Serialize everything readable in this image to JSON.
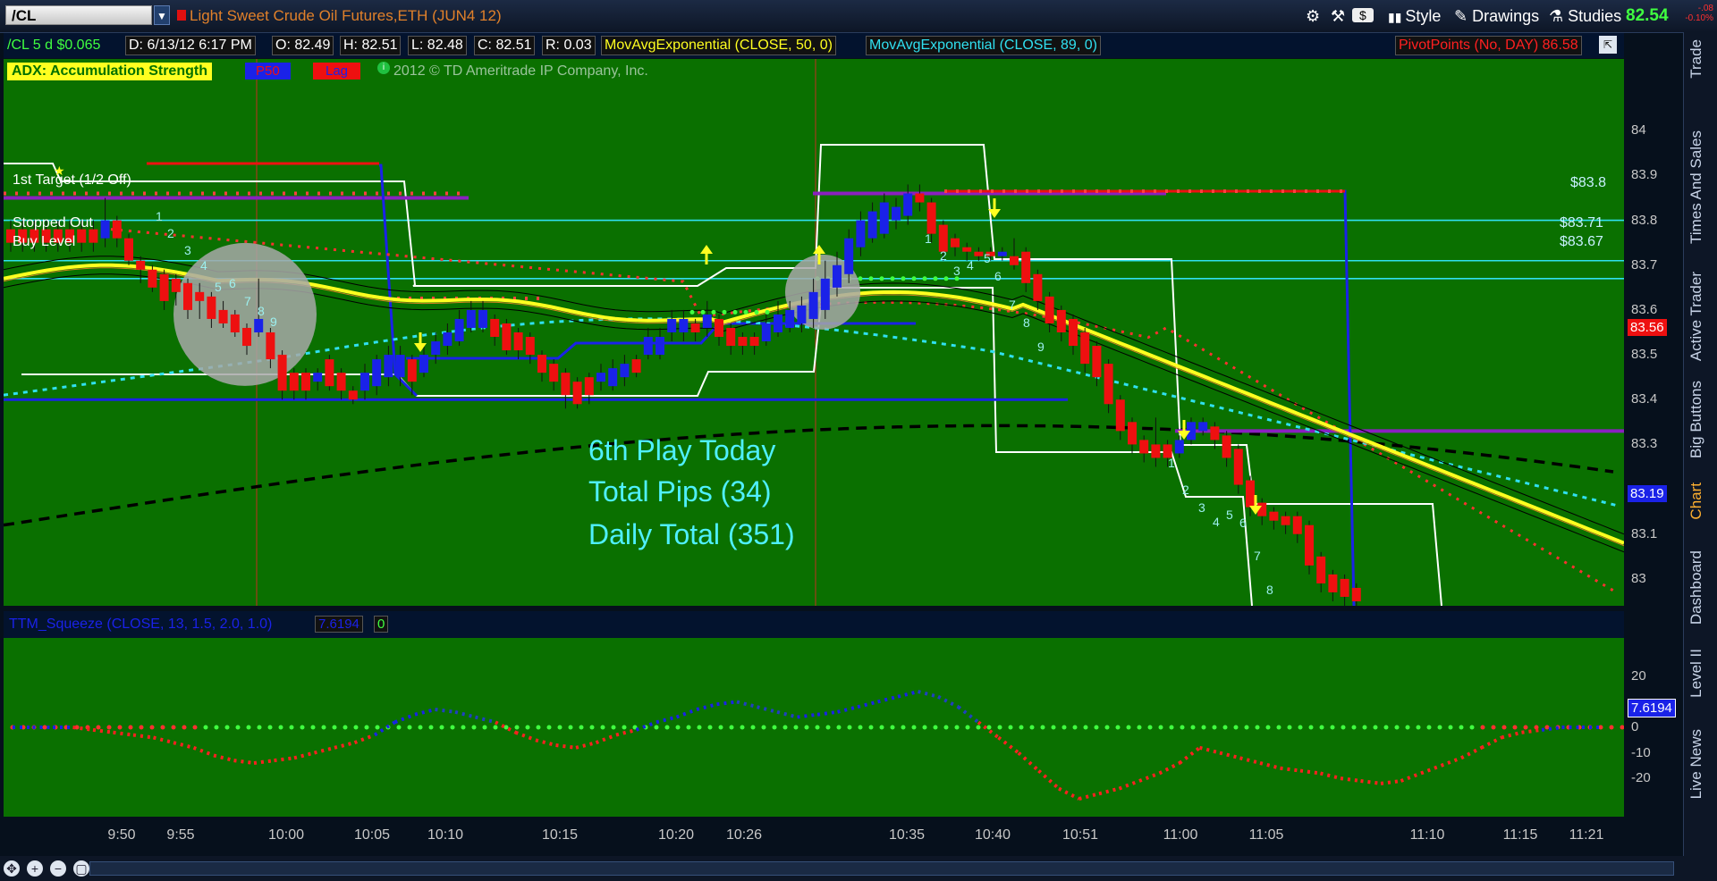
{
  "header": {
    "symbol": "/CL",
    "title": "Light Sweet Crude Oil Futures,ETH (JUN4 12)",
    "tools": {
      "style": "Style",
      "drawings": "Drawings",
      "studies": "Studies",
      "dollar": "$"
    },
    "last_price": "82.54",
    "change_line1": "-.08",
    "change_line2": "-0.10%"
  },
  "infobar": {
    "symbol_desc": "/CL 5 d $0.065",
    "date": "D: 6/13/12 6:17 PM",
    "open": "O: 82.49",
    "high": "H: 82.51",
    "low": "L: 82.48",
    "close": "C: 82.51",
    "range": "R: 0.03",
    "ema50": "MovAvgExponential (CLOSE, 50, 0)",
    "ema89": "MovAvgExponential (CLOSE, 89, 0)",
    "pivots": "PivotPoints (No, DAY)",
    "pivot_value": "86.58"
  },
  "study_bar": {
    "adx": "ADX:  Accumulation Strength",
    "p50": "P50",
    "lag": "Lag",
    "copyright": "2012 © TD Ameritrade IP Company, Inc."
  },
  "chart_labels": {
    "first_target": "1st Target (1/2 Off)",
    "stopped_out": "Stopped Out",
    "buy_level": "Buy Level",
    "level_1": "$83.8",
    "level_2": "$83.71",
    "level_3": "$83.67",
    "play": "6th Play Today",
    "pips": "Total Pips (34)",
    "daily": "Daily Total (351)"
  },
  "lower": {
    "title": "TTM_Squeeze (CLOSE, 13, 1.5, 2.0, 1.0)",
    "value": "7.6194",
    "alert": "0"
  },
  "sidebar_tabs": [
    "Trade",
    "Times And Sales",
    "Active Trader",
    "Big Buttons",
    "Chart",
    "Dashboard",
    "Level II",
    "Live News"
  ],
  "colors": {
    "chart_bg": "#0a7000",
    "up": "#1a22e8",
    "down": "#ee1010",
    "ema50": "#ffff20",
    "ema89": "#30e0f0",
    "ma_long": "#000000"
  },
  "chart_data": [
    {
      "type": "candlestick",
      "title": "Light Sweet Crude Oil Futures,ETH (JUN4 12)",
      "ylim": [
        82.94,
        84.16
      ],
      "y_ticks": [
        84,
        83.9,
        83.8,
        83.7,
        83.6,
        83.5,
        83.4,
        83.3,
        83.2,
        83.1,
        83
      ],
      "y_tick_labels": [
        "84",
        "83.9",
        "83.8",
        "83.7",
        "83.6",
        "83.5",
        "83.4",
        "83.3",
        "",
        "83.1",
        "83"
      ],
      "x_tick_labels": [
        "9:50",
        "9:55",
        "10:00",
        "10:05",
        "10:10",
        "10:15",
        "10:20",
        "10:26",
        "10:35",
        "10:40",
        "10:51",
        "11:00",
        "11:05",
        "11:10",
        "11:15",
        "11:21"
      ],
      "price_badges": [
        {
          "value": "83.56",
          "color": "#ee1010"
        },
        {
          "value": "83.19",
          "color": "#1a22e8"
        }
      ],
      "horizontal_levels": [
        83.8,
        83.71,
        83.67
      ],
      "candles": [
        [
          83.78,
          83.75,
          83.8,
          83.73
        ],
        [
          83.78,
          83.75,
          83.8,
          83.73
        ],
        [
          83.78,
          83.75,
          83.8,
          83.73
        ],
        [
          83.78,
          83.75,
          83.8,
          83.73
        ],
        [
          83.78,
          83.75,
          83.8,
          83.73
        ],
        [
          83.78,
          83.75,
          83.8,
          83.73
        ],
        [
          83.78,
          83.75,
          83.8,
          83.73
        ],
        [
          83.78,
          83.75,
          83.8,
          83.73
        ],
        [
          83.76,
          83.8,
          83.85,
          83.74
        ],
        [
          83.8,
          83.76,
          83.81,
          83.74
        ],
        [
          83.76,
          83.71,
          83.77,
          83.7
        ],
        [
          83.71,
          83.69,
          83.72,
          83.66
        ],
        [
          83.69,
          83.65,
          83.7,
          83.64
        ],
        [
          83.68,
          83.62,
          83.69,
          83.6
        ],
        [
          83.67,
          83.64,
          83.68,
          83.61
        ],
        [
          83.66,
          83.6,
          83.67,
          83.58
        ],
        [
          83.64,
          83.62,
          83.66,
          83.58
        ],
        [
          83.63,
          83.58,
          83.64,
          83.56
        ],
        [
          83.6,
          83.57,
          83.62,
          83.56
        ],
        [
          83.59,
          83.55,
          83.6,
          83.54
        ],
        [
          83.56,
          83.52,
          83.57,
          83.5
        ],
        [
          83.55,
          83.58,
          83.67,
          83.54
        ],
        [
          83.55,
          83.49,
          83.56,
          83.47
        ],
        [
          83.5,
          83.42,
          83.51,
          83.4
        ],
        [
          83.46,
          83.42,
          83.47,
          83.4
        ],
        [
          83.46,
          83.42,
          83.47,
          83.4
        ],
        [
          83.44,
          83.46,
          83.47,
          83.42
        ],
        [
          83.49,
          83.43,
          83.5,
          83.42
        ],
        [
          83.46,
          83.42,
          83.47,
          83.4
        ],
        [
          83.42,
          83.4,
          83.43,
          83.39
        ],
        [
          83.42,
          83.46,
          83.48,
          83.4
        ],
        [
          83.43,
          83.49,
          83.5,
          83.41
        ],
        [
          83.45,
          83.5,
          83.52,
          83.43
        ],
        [
          83.45,
          83.5,
          83.52,
          83.43
        ],
        [
          83.49,
          83.44,
          83.5,
          83.41
        ],
        [
          83.46,
          83.5,
          83.52,
          83.45
        ],
        [
          83.5,
          83.53,
          83.55,
          83.48
        ],
        [
          83.52,
          83.55,
          83.57,
          83.5
        ],
        [
          83.53,
          83.58,
          83.6,
          83.52
        ],
        [
          83.56,
          83.6,
          83.62,
          83.55
        ],
        [
          83.56,
          83.6,
          83.62,
          83.55
        ],
        [
          83.58,
          83.54,
          83.59,
          83.52
        ],
        [
          83.57,
          83.51,
          83.58,
          83.5
        ],
        [
          83.55,
          83.51,
          83.56,
          83.49
        ],
        [
          83.54,
          83.5,
          83.55,
          83.48
        ],
        [
          83.5,
          83.46,
          83.51,
          83.44
        ],
        [
          83.48,
          83.44,
          83.49,
          83.42
        ],
        [
          83.46,
          83.41,
          83.47,
          83.38
        ],
        [
          83.44,
          83.39,
          83.45,
          83.38
        ],
        [
          83.45,
          83.41,
          83.46,
          83.39
        ],
        [
          83.44,
          83.46,
          83.48,
          83.42
        ],
        [
          83.43,
          83.47,
          83.49,
          83.42
        ],
        [
          83.45,
          83.48,
          83.5,
          83.43
        ],
        [
          83.49,
          83.46,
          83.5,
          83.45
        ],
        [
          83.5,
          83.54,
          83.56,
          83.49
        ],
        [
          83.5,
          83.54,
          83.56,
          83.49
        ],
        [
          83.55,
          83.58,
          83.6,
          83.53
        ],
        [
          83.55,
          83.58,
          83.6,
          83.53
        ],
        [
          83.57,
          83.55,
          83.58,
          83.53
        ],
        [
          83.56,
          83.59,
          83.62,
          83.54
        ],
        [
          83.58,
          83.54,
          83.59,
          83.52
        ],
        [
          83.56,
          83.52,
          83.57,
          83.5
        ],
        [
          83.54,
          83.52,
          83.55,
          83.5
        ],
        [
          83.54,
          83.52,
          83.55,
          83.5
        ],
        [
          83.53,
          83.57,
          83.59,
          83.52
        ],
        [
          83.55,
          83.59,
          83.62,
          83.54
        ],
        [
          83.56,
          83.6,
          83.62,
          83.55
        ],
        [
          83.57,
          83.61,
          83.63,
          83.55
        ],
        [
          83.58,
          83.64,
          83.67,
          83.56
        ],
        [
          83.6,
          83.67,
          83.71,
          83.58
        ],
        [
          83.65,
          83.7,
          83.73,
          83.63
        ],
        [
          83.68,
          83.76,
          83.78,
          83.66
        ],
        [
          83.74,
          83.8,
          83.82,
          83.72
        ],
        [
          83.76,
          83.82,
          83.84,
          83.75
        ],
        [
          83.77,
          83.84,
          83.86,
          83.76
        ],
        [
          83.8,
          83.83,
          83.85,
          83.78
        ],
        [
          83.81,
          83.86,
          83.88,
          83.79
        ],
        [
          83.86,
          83.84,
          83.88,
          83.82
        ],
        [
          83.84,
          83.77,
          83.85,
          83.75
        ],
        [
          83.79,
          83.73,
          83.8,
          83.71
        ],
        [
          83.76,
          83.74,
          83.77,
          83.72
        ],
        [
          83.74,
          83.73,
          83.75,
          83.71
        ],
        [
          83.73,
          83.72,
          83.74,
          83.71
        ],
        [
          83.73,
          83.72,
          83.74,
          83.71
        ],
        [
          83.72,
          83.73,
          83.74,
          83.71
        ],
        [
          83.72,
          83.7,
          83.76,
          83.69
        ],
        [
          83.73,
          83.66,
          83.74,
          83.64
        ],
        [
          83.68,
          83.62,
          83.69,
          83.6
        ],
        [
          83.63,
          83.57,
          83.64,
          83.55
        ],
        [
          83.6,
          83.55,
          83.61,
          83.53
        ],
        [
          83.58,
          83.52,
          83.59,
          83.5
        ],
        [
          83.55,
          83.48,
          83.56,
          83.46
        ],
        [
          83.52,
          83.45,
          83.53,
          83.43
        ],
        [
          83.48,
          83.39,
          83.49,
          83.37
        ],
        [
          83.4,
          83.33,
          83.41,
          83.31
        ],
        [
          83.35,
          83.3,
          83.36,
          83.28
        ],
        [
          83.31,
          83.28,
          83.32,
          83.26
        ],
        [
          83.3,
          83.27,
          83.36,
          83.25
        ],
        [
          83.3,
          83.27,
          83.31,
          83.25
        ],
        [
          83.28,
          83.31,
          83.32,
          83.27
        ],
        [
          83.31,
          83.35,
          83.36,
          83.3
        ],
        [
          83.33,
          83.35,
          83.36,
          83.32
        ],
        [
          83.34,
          83.31,
          83.35,
          83.29
        ],
        [
          83.32,
          83.27,
          83.33,
          83.25
        ],
        [
          83.29,
          83.21,
          83.3,
          83.19
        ],
        [
          83.22,
          83.16,
          83.23,
          83.14
        ],
        [
          83.17,
          83.14,
          83.18,
          83.12
        ],
        [
          83.15,
          83.13,
          83.16,
          83.11
        ],
        [
          83.14,
          83.12,
          83.15,
          83.1
        ],
        [
          83.14,
          83.1,
          83.15,
          83.08
        ],
        [
          83.12,
          83.03,
          83.13,
          83.01
        ],
        [
          83.05,
          82.99,
          83.06,
          82.97
        ],
        [
          83.01,
          82.97,
          83.02,
          82.95
        ],
        [
          83.0,
          82.96,
          83.01,
          82.94
        ],
        [
          82.98,
          82.95,
          82.99,
          82.94
        ]
      ]
    },
    {
      "type": "line",
      "title": "TTM_Squeeze (CLOSE, 13, 1.5, 2.0, 1.0)",
      "ylim": [
        -28,
        28
      ],
      "y_ticks": [
        20,
        0,
        -10,
        -20
      ],
      "y_tick_labels": [
        "20",
        "0",
        "-10",
        "-20"
      ],
      "current_value": "7.6194",
      "x": [
        0,
        25,
        50,
        75,
        100,
        125,
        150,
        175,
        200,
        225,
        250,
        275,
        300,
        325,
        350,
        375,
        400,
        425,
        450,
        475,
        500,
        525,
        550,
        575,
        600,
        625,
        650,
        675,
        700,
        725,
        750,
        775,
        800,
        825,
        850,
        875,
        900,
        925,
        950,
        975,
        1000,
        1025,
        1050,
        1075,
        1100,
        1125,
        1150,
        1175,
        1200,
        1225,
        1250,
        1275,
        1300,
        1325,
        1350,
        1375,
        1400,
        1425,
        1450,
        1475
      ],
      "values": [
        0,
        0,
        0,
        0,
        -1,
        -2,
        -3,
        -4,
        -6,
        -8,
        -11,
        -13,
        -14,
        -13,
        -12,
        -10,
        -8,
        -6,
        -3,
        2,
        5,
        7,
        6,
        4,
        2,
        -2,
        -5,
        -7,
        -8,
        -6,
        -3,
        -1,
        2,
        4,
        7,
        9,
        10,
        8,
        6,
        4,
        5,
        6,
        8,
        10,
        12,
        14,
        12,
        8,
        2,
        -4,
        -10,
        -17,
        -24,
        -28,
        -26,
        -24,
        -21,
        -18,
        -14,
        -8
      ],
      "values_tail": [
        -10,
        -12,
        -14,
        -16,
        -17,
        -18,
        -20,
        -21,
        -22,
        -21,
        -18,
        -15,
        -12,
        -8,
        -4,
        -2,
        -1,
        0,
        0,
        0
      ],
      "zero_line_dots": true
    }
  ]
}
